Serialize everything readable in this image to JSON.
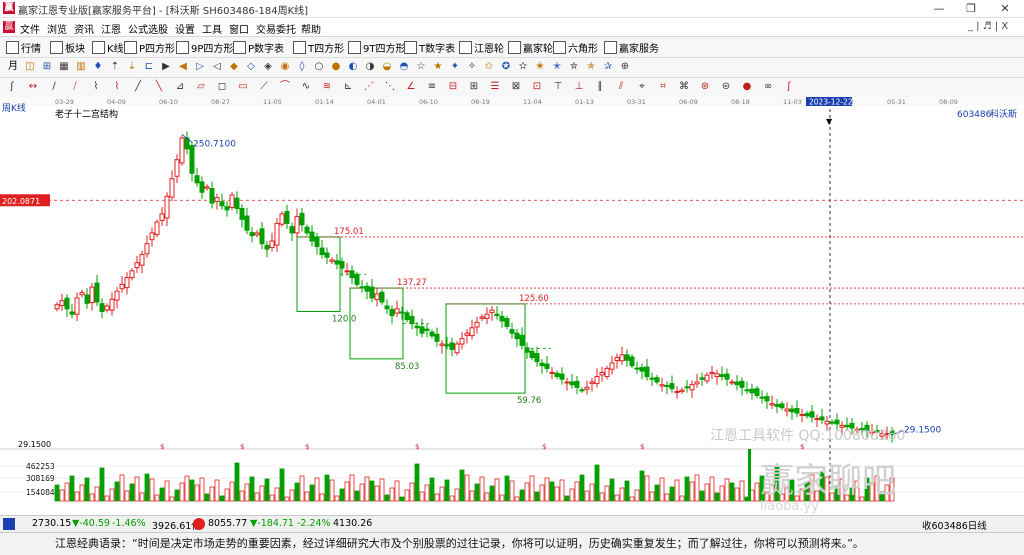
{
  "window": {
    "title": "赢家江恩专业版[赢家服务平台] - [科沃斯  SH603486-184周K线]",
    "min_label": "—",
    "max_label": "❐",
    "close_label": "✕"
  },
  "menu": {
    "items": [
      "文件",
      "浏览",
      "资讯",
      "江恩",
      "公式选股",
      "设置",
      "工具",
      "窗口",
      "交易委托",
      "帮助"
    ],
    "right_controls": "_ | ♬ | X"
  },
  "toolbar1": {
    "items": [
      {
        "label": "行情",
        "icon": "grid-icon"
      },
      {
        "label": "板块",
        "icon": "blocks-icon"
      },
      {
        "label": "K线",
        "icon": "kline-icon"
      },
      {
        "label": "P四方形",
        "icon": "p-square-icon"
      },
      {
        "label": "9P四方形",
        "icon": "9p-square-icon"
      },
      {
        "label": "P数字表",
        "icon": "p-table-icon"
      },
      {
        "label": "T四方形",
        "icon": "t-square-icon"
      },
      {
        "label": "9T四方形",
        "icon": "9t-square-icon"
      },
      {
        "label": "T数字表",
        "icon": "t-table-icon"
      },
      {
        "label": "江恩轮",
        "icon": "gann-wheel-icon"
      },
      {
        "label": "赢家轮",
        "icon": "winner-wheel-icon"
      },
      {
        "label": "六角形",
        "icon": "hexagon-icon"
      },
      {
        "label": "赢家服务",
        "icon": "service-icon"
      }
    ]
  },
  "toolbar2": {
    "period_label": "月",
    "count": 36
  },
  "toolbar3": {
    "count": 38
  },
  "chart_header": {
    "period": "周K线",
    "indicator_name": "老子十二宫结构",
    "code": "603486",
    "name": "科沃斯",
    "date_axis": [
      "03-29",
      "04-09",
      "06-10",
      "08-27",
      "11-05",
      "01-14",
      "04-01",
      "06-10",
      "08-19",
      "11-04",
      "01-13",
      "03-31",
      "06-09",
      "08-18",
      "11-03",
      "03-22",
      "05-31",
      "08-09"
    ],
    "crosshair_date": "2023-12-22",
    "crosshair_price": "202.0871",
    "volume_axis": [
      "462253",
      "308169",
      "154084"
    ],
    "price_floor_label": "29.1500",
    "max_price_label": "250.7100",
    "min_price_label": "29.1500",
    "watermark_text": "江恩工具软件 QQ:100800360",
    "watermark_logo": "赢家聊吧",
    "watermark_url": "liaoba.yy"
  },
  "chart_data": {
    "type": "candlestick",
    "ylim": [
      20,
      265
    ],
    "weekly_closes": [
      125,
      128,
      122,
      118,
      130,
      134,
      126,
      138,
      127,
      120,
      124,
      129,
      135,
      140,
      145,
      150,
      156,
      162,
      170,
      178,
      186,
      192,
      205,
      218,
      232,
      248,
      240,
      222,
      215,
      208,
      212,
      200,
      204,
      198,
      195,
      206,
      196,
      188,
      180,
      176,
      178,
      170,
      166,
      172,
      185,
      192,
      185,
      178,
      190,
      184,
      178,
      172,
      168,
      162,
      160,
      158,
      155,
      152,
      150,
      145,
      140,
      138,
      135,
      130,
      133,
      127,
      122,
      117,
      122,
      119,
      114,
      111,
      108,
      104,
      106,
      102,
      98,
      96,
      95,
      92,
      96,
      100,
      104,
      108,
      112,
      116,
      118,
      121,
      117,
      113,
      109,
      104,
      100,
      95,
      90,
      86,
      83,
      80,
      78,
      75,
      72,
      70,
      68,
      66,
      64,
      62,
      64,
      68,
      72,
      75,
      78,
      82,
      86,
      88,
      84,
      80,
      78,
      76,
      72,
      70,
      68,
      66,
      65,
      63,
      61,
      62,
      64,
      66,
      68,
      70,
      73,
      75,
      74,
      72,
      70,
      68,
      66,
      64,
      62,
      60,
      58,
      56,
      54,
      52,
      50,
      49,
      48,
      46,
      45,
      44,
      43,
      42,
      41,
      40,
      39,
      38,
      37,
      36,
      35,
      34,
      33,
      33,
      32,
      31,
      31,
      30,
      30,
      29.15
    ],
    "boxes": [
      {
        "low": 120.0,
        "high": 175.01,
        "label_high": "175.01",
        "label_low": "120.0"
      },
      {
        "low": 85.03,
        "high": 137.27,
        "label_high": "137.27",
        "label_low": "85.03"
      },
      {
        "low": 59.76,
        "high": 125.6,
        "label_high": "125.60",
        "label_low": "59.76"
      }
    ],
    "price_labels": [
      "250.7100",
      "175.01",
      "137.27",
      "125.60",
      "120.0",
      "85.03",
      "59.76",
      "29.1500"
    ]
  },
  "statusbar": {
    "sh_index": "2730.15",
    "sh_change": "▼-40.59",
    "sh_pct": "-1.46%",
    "sh_amount": "3926.61亿",
    "sz_index": "8055.77",
    "sz_change": "▼-184.71",
    "sz_pct": "-2.24%",
    "sz_amount": "4130.26",
    "right_label": "收603486日线"
  },
  "quote": {
    "text": "江恩经典语录：“时间是决定市场走势的重要因素，经过详细研究大市及个别股票的过往记录，你将可以证明，历史确实重复发生；而了解过往，你将可以预测将来。”。"
  },
  "colors": {
    "up": "#e02020",
    "down": "#00a000",
    "box": "#00a000",
    "level": "#e02020",
    "accent": "#1a3fb0"
  }
}
